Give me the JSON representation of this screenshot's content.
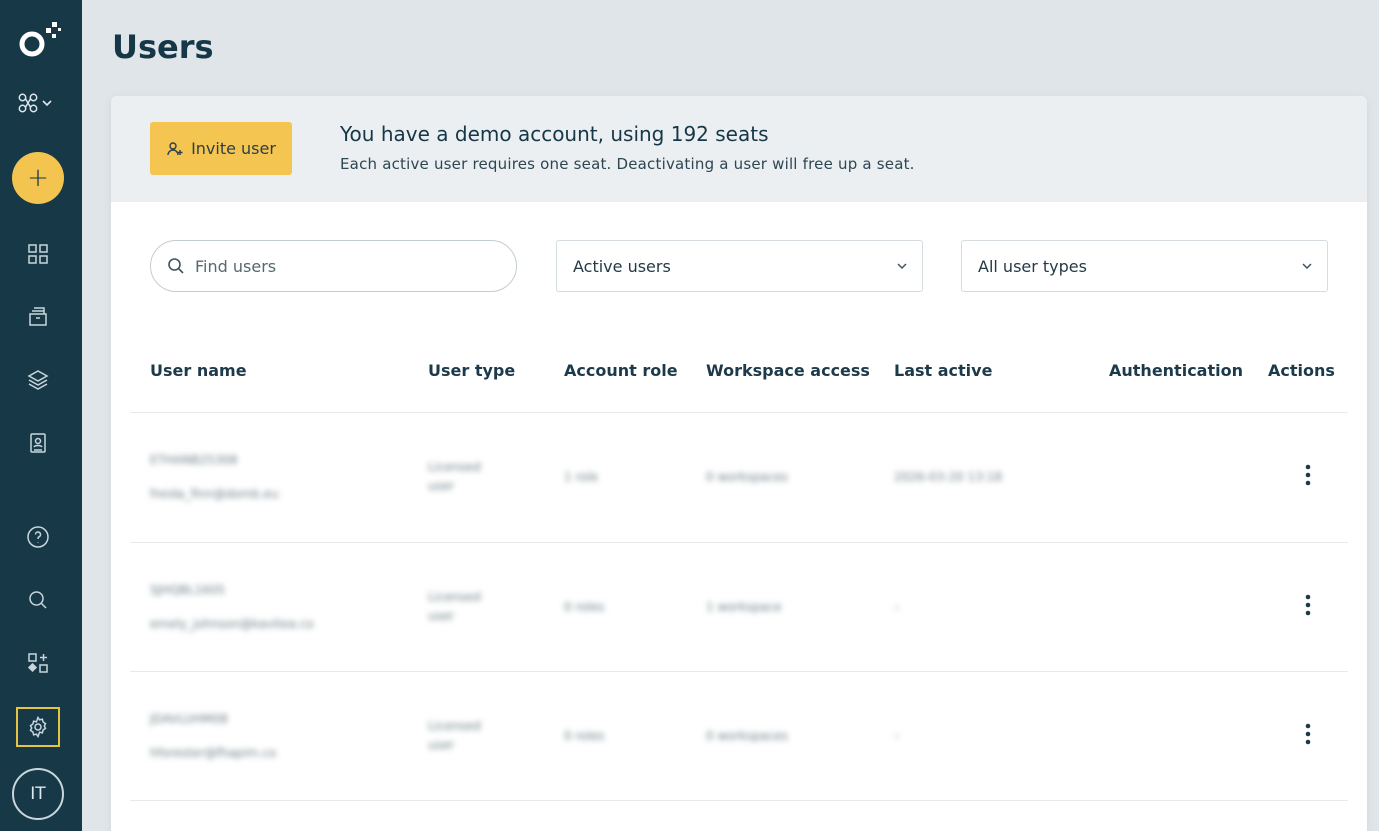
{
  "sidebar": {
    "avatar_initials": "IT",
    "add_label": "+"
  },
  "page": {
    "title": "Users"
  },
  "banner": {
    "invite_label": "Invite user",
    "title": "You have a demo account, using 192 seats",
    "subtitle": "Each active user requires one seat. Deactivating a user will free up a seat."
  },
  "filters": {
    "search_placeholder": "Find users",
    "status_value": "Active users",
    "type_value": "All user types"
  },
  "table": {
    "columns": [
      "User name",
      "User type",
      "Account role",
      "Workspace access",
      "Last active",
      "Authentication",
      "Actions"
    ],
    "rows": [
      {
        "name": "ETHANB25308",
        "email": "freida_finn@domb.eu",
        "type_line1": "Licensed",
        "type_line2": "user",
        "role": "1 role",
        "workspace": "0 workspaces",
        "last_active": "2026-03-20 13:18"
      },
      {
        "name": "SJHQBL1605",
        "email": "emely_johnson@kavitea.co",
        "type_line1": "Licensed",
        "type_line2": "user",
        "role": "0 roles",
        "workspace": "1 workspace",
        "last_active": "–"
      },
      {
        "name": "JDAVLUHM08",
        "email": "hforester@fhapim.co",
        "type_line1": "Licensed",
        "type_line2": "user",
        "role": "0 roles",
        "workspace": "0 workspaces",
        "last_active": "–"
      }
    ]
  }
}
